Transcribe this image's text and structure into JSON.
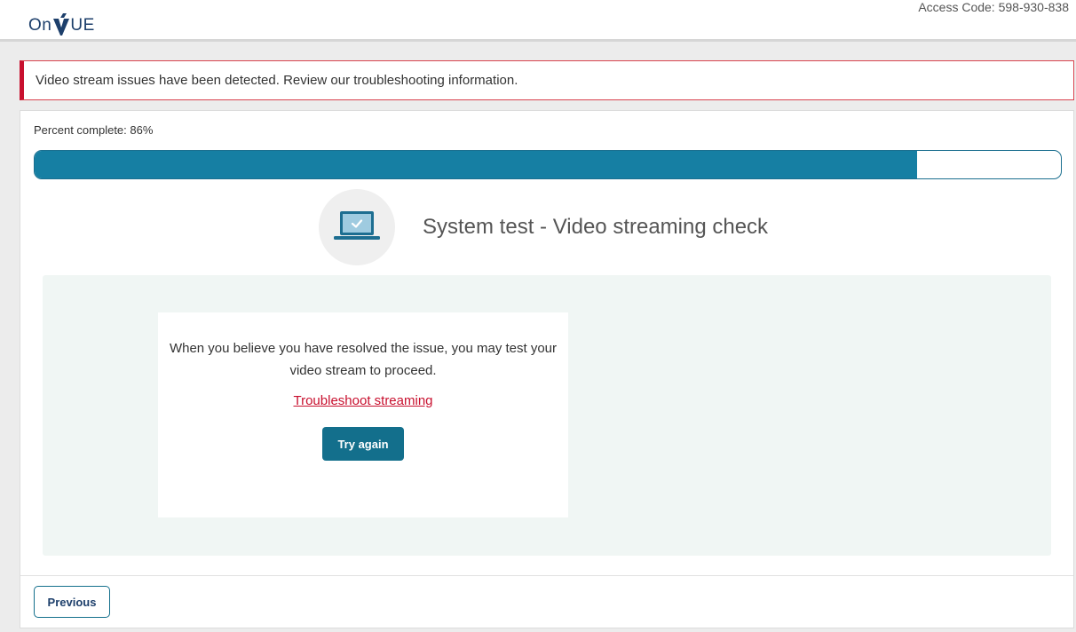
{
  "header": {
    "logo_on": "On",
    "logo_v_icon": "onvue-v-mark",
    "logo_ue": "UE",
    "access_code": "Access Code: 598-930-838"
  },
  "alert": {
    "message": "Video stream issues have been detected. Review our troubleshooting information.",
    "border_color": "#c8102e"
  },
  "progress": {
    "label": "Percent complete: 86%",
    "value_percent": 86,
    "fill_color": "#167fa3"
  },
  "section": {
    "icon": "laptop-check-icon",
    "title": "System test - Video streaming check"
  },
  "panel": {
    "message": "When you believe you have resolved the issue, you may test your video stream to proceed.",
    "link_label": "Troubleshoot streaming",
    "button_label": "Try again"
  },
  "footer": {
    "previous_label": "Previous"
  },
  "colors": {
    "accent": "#136f8c",
    "brand_navy": "#1d3f6b",
    "error": "#c8102e",
    "panel_bg": "#f0f6f4"
  }
}
